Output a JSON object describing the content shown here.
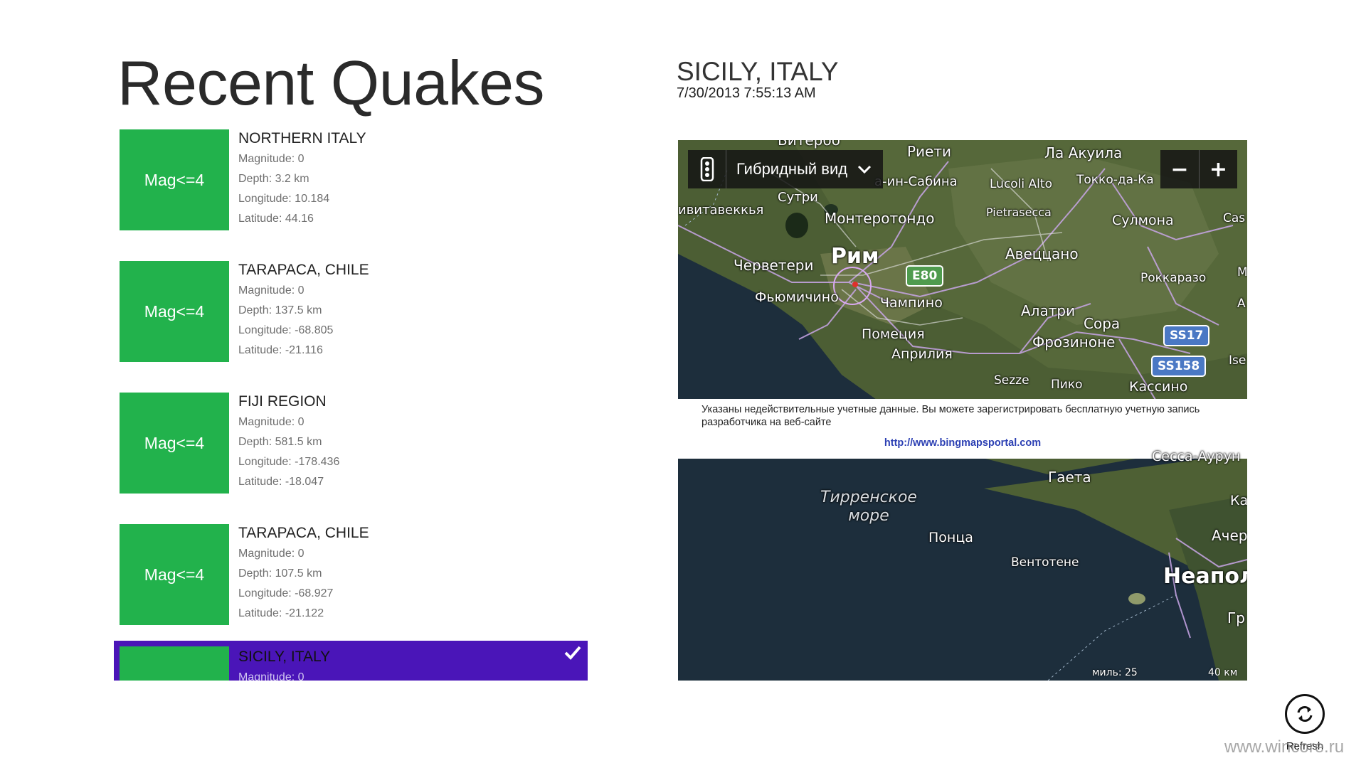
{
  "page": {
    "title": "Recent Quakes"
  },
  "quakes": [
    {
      "tile": "Mag<=4",
      "region": "NORTHERN ITALY",
      "magnitude": "Magnitude: 0",
      "depth": "Depth: 3.2 km",
      "longitude": "Longitude: 10.184",
      "latitude": "Latitude: 44.16"
    },
    {
      "tile": "Mag<=4",
      "region": "TARAPACA, CHILE",
      "magnitude": "Magnitude: 0",
      "depth": "Depth: 137.5 km",
      "longitude": "Longitude: -68.805",
      "latitude": "Latitude: -21.116"
    },
    {
      "tile": "Mag<=4",
      "region": "FIJI REGION",
      "magnitude": "Magnitude: 0",
      "depth": "Depth: 581.5 km",
      "longitude": "Longitude: -178.436",
      "latitude": "Latitude: -18.047"
    },
    {
      "tile": "Mag<=4",
      "region": "TARAPACA, CHILE",
      "magnitude": "Magnitude: 0",
      "depth": "Depth: 107.5 km",
      "longitude": "Longitude: -68.927",
      "latitude": "Latitude: -21.122"
    },
    {
      "tile": "",
      "region": "SICILY, ITALY",
      "magnitude": "Magnitude: 0",
      "depth": "",
      "longitude": "",
      "latitude": "",
      "selected": true
    }
  ],
  "detail": {
    "title": "SICILY, ITALY",
    "datetime": "7/30/2013 7:55:13 AM"
  },
  "map": {
    "view_mode": "Гибридный вид",
    "zoom_out": "−",
    "zoom_in": "+",
    "labels": {
      "viterbo": "Витербо",
      "rieti": "Риети",
      "la_akuila": "Ла Акуила",
      "sabina": "а-ин-Сабина",
      "lucoli": "Lucoli Alto",
      "tokko": "Токко-да-Ка",
      "sutri": "Сутри",
      "civitavecchia": "ивитавеккья",
      "monterotondo": "Монтеротондо",
      "pietrasecca": "Pietrasecca",
      "sulmona": "Сулмона",
      "cas": "Cas",
      "cerveteri": "Черветери",
      "rome": "Рим",
      "avezzano": "Авеццано",
      "roccaraso": "Роккаразо",
      "m": "М",
      "fiumicino": "Фьюмичино",
      "ciampino": "Чампино",
      "alatri": "Алатри",
      "a": "А",
      "sora": "Сора",
      "pomezia": "Помеция",
      "frosinone": "Фрозиноне",
      "aprilia": "Априлия",
      "ise": "Ise",
      "sezze": "Sezze",
      "piko": "Пико",
      "cassino": "Кассино",
      "sessa": "Сесса-Аурун",
      "gaeta": "Гаета",
      "sea_line1": "Тирренское",
      "sea_line2": "море",
      "ka": "Ка",
      "ponza": "Понца",
      "acher": "Ачер",
      "ventotene": "Вентотене",
      "naples": "Неапол",
      "gr": "Гр"
    },
    "roads": {
      "e80": "E80",
      "ss17": "SS17",
      "ss158": "SS158"
    },
    "credential_message": "Указаны недействительные учетные данные. Вы можете зарегистрировать бесплатную учетную запись разработчика на веб-сайте",
    "credential_link": "http://www.bingmapsportal.com",
    "scale_miles": "миль: 25",
    "scale_km": "40 км"
  },
  "appbar": {
    "refresh_label": "Refresh"
  },
  "watermark": "www.wincore.ru",
  "icons": {
    "traffic": "traffic-light-icon",
    "chevron": "chevron-down-icon",
    "refresh": "refresh-icon",
    "check": "check-icon"
  },
  "colors": {
    "tile": "#22b24c",
    "selection": "#4a15b8",
    "link": "#2b3fb3"
  }
}
